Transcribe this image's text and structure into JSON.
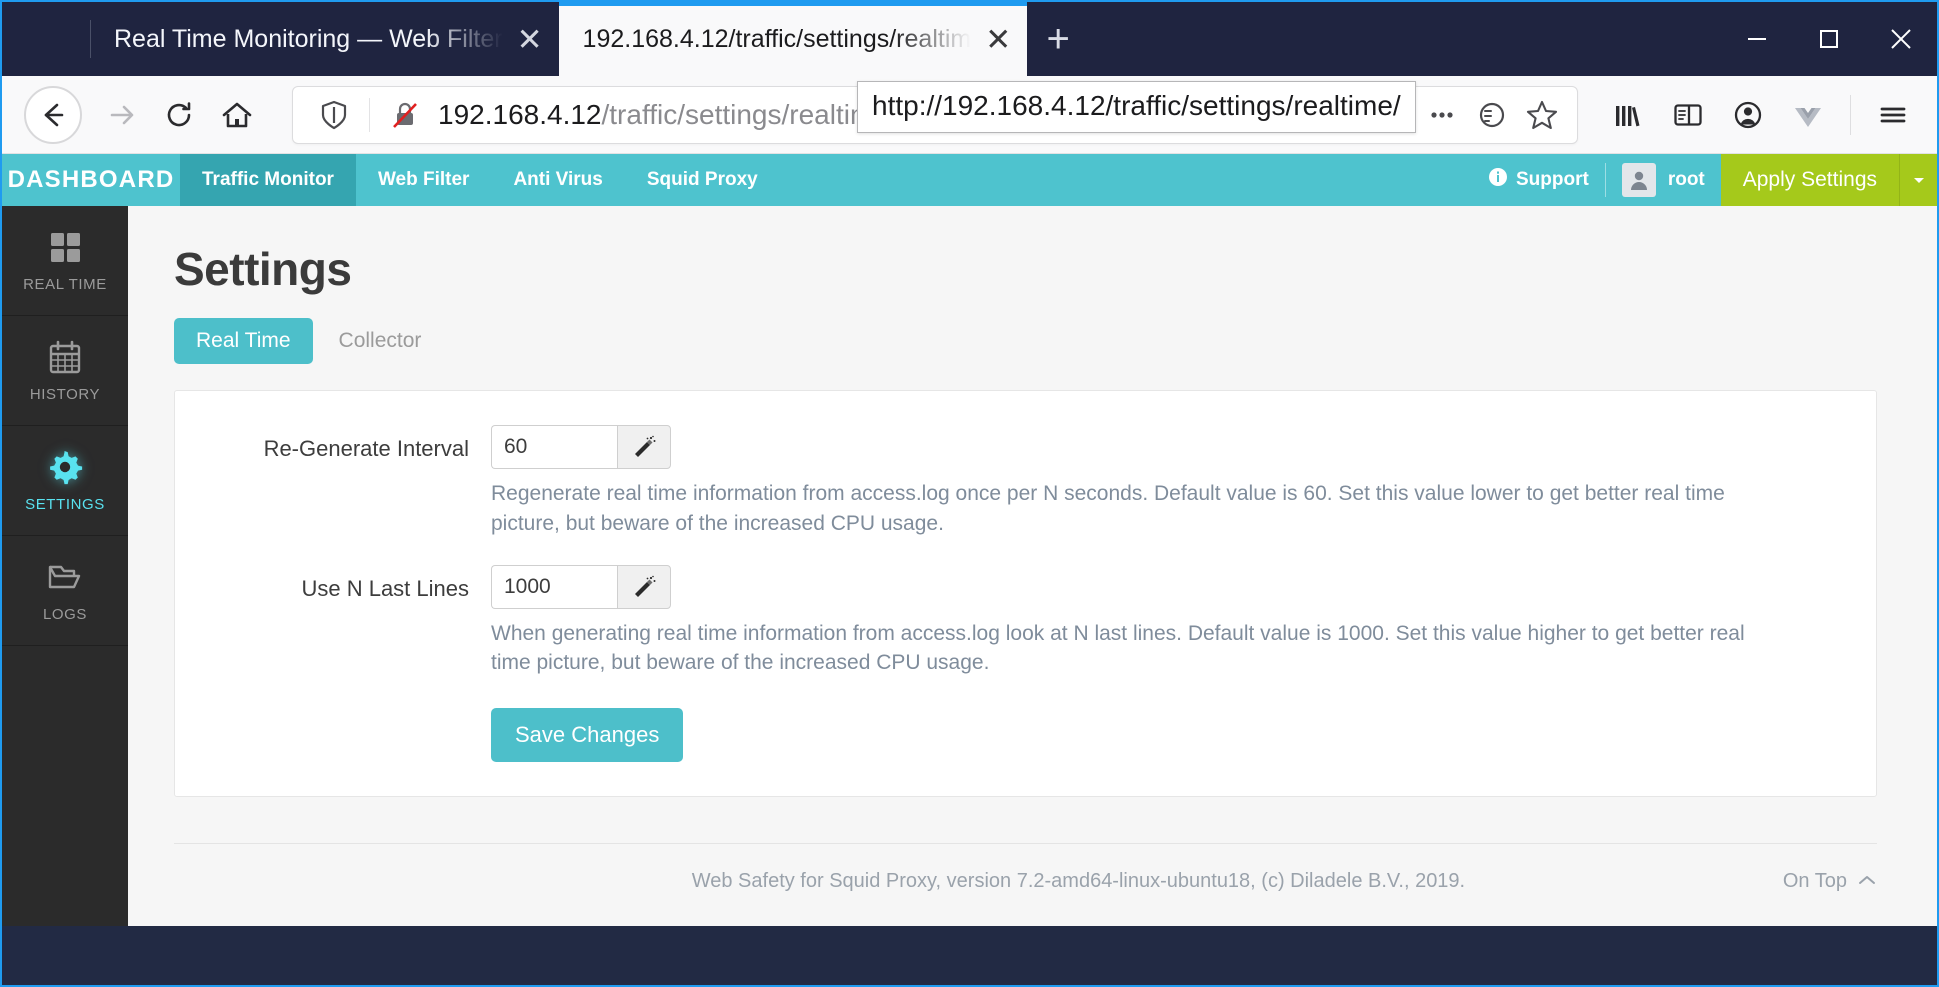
{
  "browser": {
    "tabs": [
      {
        "title": "Real Time Monitoring — Web Filter",
        "close_label": "✕",
        "active": false
      },
      {
        "title": "192.168.4.12/traffic/settings/realtim",
        "close_label": "✕",
        "active": true
      }
    ],
    "new_tab_label": "+",
    "window_controls": {
      "minimize": "minimize-button",
      "maximize": "maximize-button",
      "close": "close-button"
    },
    "url": {
      "host": "192.168.4.12",
      "path": "/traffic/settings/realtim",
      "zoom_level": "67%",
      "tooltip": "http://192.168.4.12/traffic/settings/realtime/"
    },
    "icons": {
      "back": "back-arrow-icon",
      "forward": "forward-arrow-icon",
      "reload": "reload-icon",
      "home": "home-icon",
      "shield": "tracking-protection-shield-icon",
      "no_https": "insecure-connection-icon",
      "page_actions": "page-actions-icon",
      "reader": "reader-mode-icon",
      "bookmark": "bookmark-star-icon",
      "library": "library-icon",
      "sidebar": "sidebar-icon",
      "account": "account-icon",
      "vue": "vue-devtools-icon",
      "menu": "hamburger-menu-icon"
    }
  },
  "app": {
    "brand": "DASHBOARD",
    "nav_items": [
      {
        "label": "Traffic Monitor",
        "active": true
      },
      {
        "label": "Web Filter",
        "active": false
      },
      {
        "label": "Anti Virus",
        "active": false
      },
      {
        "label": "Squid Proxy",
        "active": false
      }
    ],
    "support_label": "Support",
    "user_label": "root",
    "apply_label": "Apply Settings",
    "sidebar": [
      {
        "label": "REAL TIME",
        "icon": "grid-icon",
        "active": false
      },
      {
        "label": "HISTORY",
        "icon": "calendar-icon",
        "active": false
      },
      {
        "label": "SETTINGS",
        "icon": "gear-icon",
        "active": true
      },
      {
        "label": "LOGS",
        "icon": "folder-icon",
        "active": false
      }
    ],
    "page_title": "Settings",
    "tabs": [
      {
        "label": "Real Time",
        "active": true
      },
      {
        "label": "Collector",
        "active": false
      }
    ],
    "form": {
      "fields": [
        {
          "label": "Re-Generate Interval",
          "value": "60",
          "placeholder": "60",
          "wand": "magic-wand-icon",
          "help": "Regenerate real time information from access.log once per N seconds. Default value is 60. Set this value lower to get better real time picture, but beware of the increased CPU usage."
        },
        {
          "label": "Use N Last Lines",
          "value": "1000",
          "placeholder": "1000",
          "wand": "magic-wand-icon",
          "help": "When generating real time information from access.log look at N last lines. Default value is 1000. Set this value higher to get better real time picture, but beware of the increased CPU usage."
        }
      ],
      "save_label": "Save Changes"
    },
    "footer": {
      "copyright": "Web Safety for Squid Proxy, version 7.2-amd64-linux-ubuntu18, (c) Diladele B.V., 2019.",
      "on_top": "On Top"
    }
  },
  "colors": {
    "brand_teal": "#4ec3ce",
    "active_nav": "#35a5b0",
    "apply_green": "#a5c91b",
    "sidebar_active": "#59e2ef",
    "tab_accent": "#1f9bf0"
  }
}
